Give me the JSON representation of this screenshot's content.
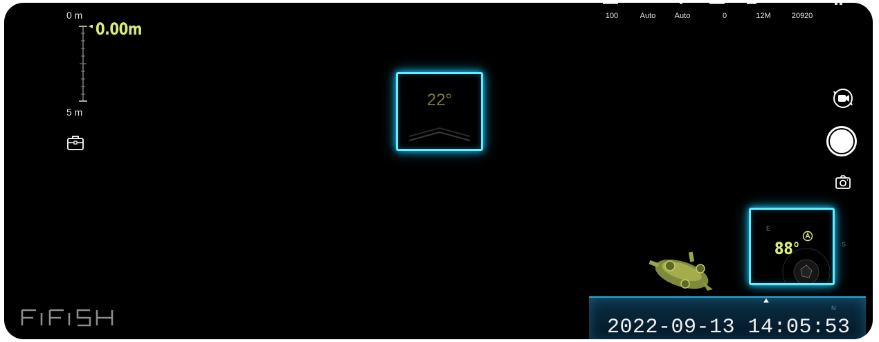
{
  "depth": {
    "top_label": "0 m",
    "bottom_label": "5 m",
    "readout": "0.00m"
  },
  "camera_params": [
    {
      "id": "iso",
      "value": "100"
    },
    {
      "id": "white-balance",
      "value": "Auto"
    },
    {
      "id": "shutter",
      "value": "Auto"
    },
    {
      "id": "ev",
      "value": "0"
    },
    {
      "id": "resolution",
      "value": "12M"
    },
    {
      "id": "remaining",
      "value": "20920"
    }
  ],
  "pitch": {
    "value": "22°"
  },
  "heading": {
    "value": "88°",
    "compass_letters": [
      "E",
      "S"
    ]
  },
  "timestamp": {
    "datetime": "2022-09-13 14:05:53",
    "marker_label": "N"
  },
  "logo": {
    "text": "FIFISH"
  },
  "icons": {
    "toolbox": "toolbox-icon",
    "mode_switch": "video-mode-switch-icon",
    "shutter": "shutter-button",
    "photo": "camera-icon",
    "auto_heading": "auto-lock-icon"
  },
  "colors": {
    "accent_cyan": "#5ff0ff",
    "readout_lime": "#d8ef7a",
    "pitch_olive": "#7c7a36",
    "background": "#000000"
  }
}
